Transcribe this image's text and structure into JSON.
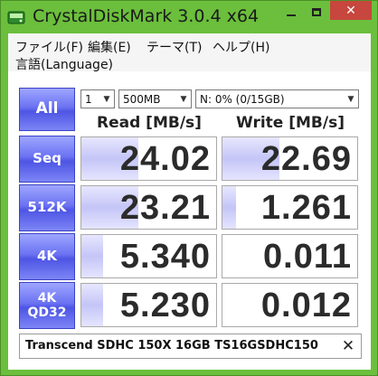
{
  "window": {
    "title": "CrystalDiskMark 3.0.4 x64",
    "close_glyph": "✕"
  },
  "menu": {
    "items": [
      "ファイル(F)",
      "編集(E)",
      "テーマ(T)",
      "ヘルプ(H)"
    ],
    "language": "言語(Language)"
  },
  "toolbar": {
    "all_label": "All",
    "runs": "1",
    "size": "500MB",
    "drive": "N: 0% (0/15GB)"
  },
  "headers": {
    "read": "Read [MB/s]",
    "write": "Write [MB/s]"
  },
  "tests": [
    {
      "label": "Seq",
      "read": "24.02",
      "write": "22.69",
      "read_level": 0.42,
      "write_level": 0.42
    },
    {
      "label": "512K",
      "read": "23.21",
      "write": "1.261",
      "read_level": 0.42,
      "write_level": 0.1
    },
    {
      "label": "4K",
      "read": "5.340",
      "write": "0.011",
      "read_level": 0.16,
      "write_level": 0.0
    },
    {
      "label": "4K\nQD32",
      "read": "5.230",
      "write": "0.012",
      "read_level": 0.16,
      "write_level": 0.0
    }
  ],
  "comment": {
    "text": "Transcend SDHC 150X 16GB TS16GSDHC150",
    "clear_glyph": "✕"
  },
  "colors": {
    "frame": "#6bbf3c",
    "button_blue": "#5a62ea",
    "close_red": "#c7463d",
    "bar_fill": "#c5c5f7"
  }
}
